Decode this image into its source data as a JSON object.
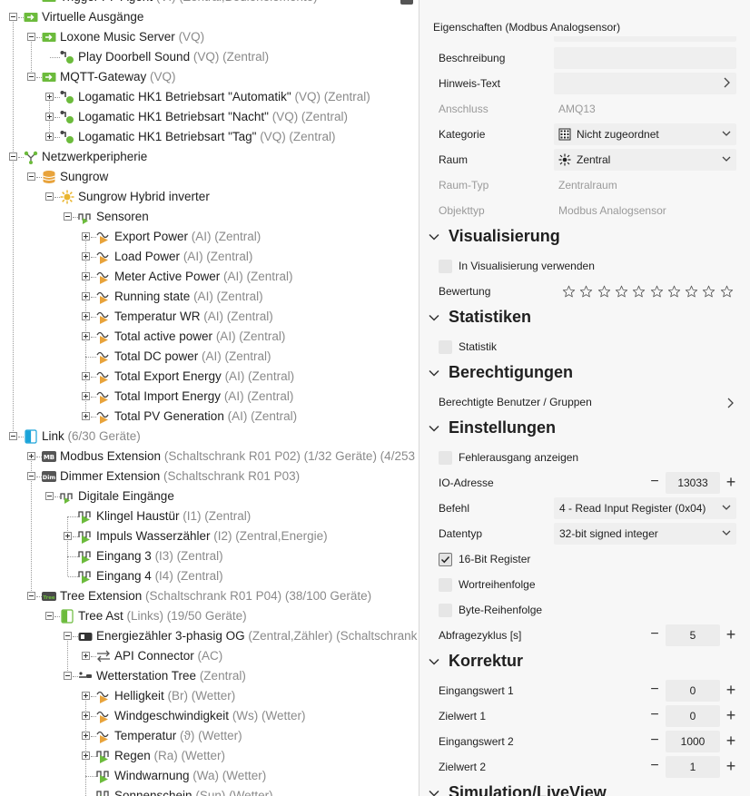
{
  "tree": {
    "rows": [
      {
        "name": "Trigger PP Agent",
        "meta": "(VI) (Zentral,Bedienelemente)",
        "icon": "virtual-input-icon"
      },
      {
        "name": "Virtuelle Ausgänge",
        "meta": "",
        "icon": "virtual-outputs-icon"
      },
      {
        "name": "Loxone Music Server",
        "meta": "(VQ)",
        "icon": "virtual-output-icon"
      },
      {
        "name": "Play Doorbell Sound",
        "meta": "(VQ) (Zentral)",
        "icon": "output-command-icon"
      },
      {
        "name": "MQTT-Gateway",
        "meta": "(VQ)",
        "icon": "virtual-output-icon"
      },
      {
        "name": "Logamatic HK1 Betriebsart \"Automatik\"",
        "meta": "(VQ) (Zentral)",
        "icon": "output-command-icon"
      },
      {
        "name": "Logamatic HK1 Betriebsart \"Nacht\"",
        "meta": "(VQ) (Zentral)",
        "icon": "output-command-icon"
      },
      {
        "name": "Logamatic HK1 Betriebsart \"Tag\"",
        "meta": "(VQ) (Zentral)",
        "icon": "output-command-icon"
      },
      {
        "name": "Netzwerkperipherie",
        "meta": "",
        "icon": "network-icon"
      },
      {
        "name": "Sungrow",
        "meta": "",
        "icon": "database-icon"
      },
      {
        "name": "Sungrow Hybrid inverter",
        "meta": "",
        "icon": "sun-icon"
      },
      {
        "name": "Sensoren",
        "meta": "",
        "icon": "sensors-icon"
      },
      {
        "name": "Export Power",
        "meta": "(AI) (Zentral)",
        "icon": "analog-input-icon"
      },
      {
        "name": "Load Power",
        "meta": "(AI) (Zentral)",
        "icon": "analog-input-icon"
      },
      {
        "name": "Meter Active Power",
        "meta": "(AI) (Zentral)",
        "icon": "analog-input-icon"
      },
      {
        "name": "Running state",
        "meta": "(AI) (Zentral)",
        "icon": "analog-input-icon"
      },
      {
        "name": "Temperatur WR",
        "meta": "(AI) (Zentral)",
        "icon": "analog-input-icon"
      },
      {
        "name": "Total active power",
        "meta": "(AI) (Zentral)",
        "icon": "analog-input-icon"
      },
      {
        "name": "Total DC power",
        "meta": "(AI) (Zentral)",
        "icon": "analog-input-icon"
      },
      {
        "name": "Total Export Energy",
        "meta": "(AI) (Zentral)",
        "icon": "analog-input-icon"
      },
      {
        "name": "Total Import Energy",
        "meta": "(AI) (Zentral)",
        "icon": "analog-input-icon"
      },
      {
        "name": "Total PV Generation",
        "meta": "(AI) (Zentral)",
        "icon": "analog-input-icon"
      },
      {
        "name": "Link",
        "meta": "(6/30 Geräte)",
        "icon": "link-icon"
      },
      {
        "name": "Modbus Extension",
        "meta": "(Schaltschrank R01 P02) (1/32 Geräte) (4/253",
        "icon": "modbus-extension-icon"
      },
      {
        "name": "Dimmer Extension",
        "meta": "(Schaltschrank R01 P03)",
        "icon": "dimmer-extension-icon"
      },
      {
        "name": "Digitale Eingänge",
        "meta": "",
        "icon": "digital-inputs-icon"
      },
      {
        "name": "Klingel Haustür",
        "meta": "(I1) (Zentral)",
        "icon": "digital-input-icon"
      },
      {
        "name": "Impuls Wasserzähler",
        "meta": "(I2) (Zentral,Energie)",
        "icon": "digital-input-icon"
      },
      {
        "name": "Eingang 3",
        "meta": "(I3) (Zentral)",
        "icon": "digital-input-icon"
      },
      {
        "name": "Eingang 4",
        "meta": "(I4) (Zentral)",
        "icon": "digital-input-icon"
      },
      {
        "name": "Tree Extension",
        "meta": "(Schaltschrank R01 P04) (38/100 Geräte)",
        "icon": "tree-extension-icon"
      },
      {
        "name": "Tree Ast",
        "meta": "(Links) (19/50 Geräte)",
        "icon": "tree-branch-icon"
      },
      {
        "name": "Energiezähler 3-phasig OG",
        "meta": "(Zentral,Zähler) (Schaltschrank",
        "icon": "energy-meter-icon"
      },
      {
        "name": "API Connector",
        "meta": "(AC)",
        "icon": "api-connector-icon"
      },
      {
        "name": "Wetterstation Tree",
        "meta": "(Zentral)",
        "icon": "weather-station-icon"
      },
      {
        "name": "Helligkeit",
        "meta": "(Br) (Wetter)",
        "icon": "analog-input-icon"
      },
      {
        "name": "Windgeschwindigkeit",
        "meta": "(Ws) (Wetter)",
        "icon": "analog-input-icon"
      },
      {
        "name": "Temperatur",
        "meta": "(ϑ) (Wetter)",
        "icon": "analog-input-icon"
      },
      {
        "name": "Regen",
        "meta": "(Ra) (Wetter)",
        "icon": "digital-input-icon"
      },
      {
        "name": "Windwarnung",
        "meta": "(Wa) (Wetter)",
        "icon": "digital-input-icon"
      },
      {
        "name": "Sonnenschein",
        "meta": "(Sun) (Wetter)",
        "icon": "digital-input-icon"
      }
    ]
  },
  "props": {
    "header": "Eigenschaften (Modbus Analogsensor)",
    "fields": {
      "beschreibung_label": "Beschreibung",
      "hinweis_label": "Hinweis-Text",
      "anschluss_label": "Anschluss",
      "anschluss_value": "AMQ13",
      "kategorie_label": "Kategorie",
      "kategorie_value": "Nicht zugeordnet",
      "raum_label": "Raum",
      "raum_value": "Zentral",
      "raumtyp_label": "Raum-Typ",
      "raumtyp_value": "Zentralraum",
      "objekttyp_label": "Objekttyp",
      "objekttyp_value": "Modbus Analogsensor"
    },
    "visualisierung": {
      "title": "Visualisierung",
      "use_label": "In Visualisierung verwenden",
      "use_checked": false,
      "rating_label": "Bewertung",
      "rating_stars": 10,
      "rating_value": 0
    },
    "statistiken": {
      "title": "Statistiken",
      "statistik_label": "Statistik",
      "statistik_checked": false
    },
    "berechtigungen": {
      "title": "Berechtigungen",
      "users_label": "Berechtigte Benutzer / Gruppen"
    },
    "einstellungen": {
      "title": "Einstellungen",
      "fehler_label": "Fehlerausgang anzeigen",
      "fehler_checked": false,
      "io_label": "IO-Adresse",
      "io_value": "13033",
      "befehl_label": "Befehl",
      "befehl_value": "4 - Read Input Register (0x04)",
      "datentyp_label": "Datentyp",
      "datentyp_value": "32-bit signed integer",
      "bit16_label": "16-Bit Register",
      "bit16_checked": true,
      "wort_label": "Wortreihenfolge",
      "wort_checked": false,
      "byte_label": "Byte-Reihenfolge",
      "byte_checked": false,
      "zyklus_label": "Abfragezyklus [s]",
      "zyklus_value": "5"
    },
    "korrektur": {
      "title": "Korrektur",
      "ein1_label": "Eingangswert 1",
      "ein1_value": "0",
      "ziel1_label": "Zielwert 1",
      "ziel1_value": "0",
      "ein2_label": "Eingangswert 2",
      "ein2_value": "1000",
      "ziel2_label": "Zielwert 2",
      "ziel2_value": "1"
    },
    "simulation": {
      "title": "Simulation/LiveView"
    }
  },
  "colors": {
    "accent_green": "#6cbb3c",
    "accent_orange": "#e8a33b",
    "meta_gray": "#8a8a8a",
    "panel_bg": "#f7f7f7"
  },
  "symbols": {
    "minus": "−",
    "plus": "+"
  }
}
